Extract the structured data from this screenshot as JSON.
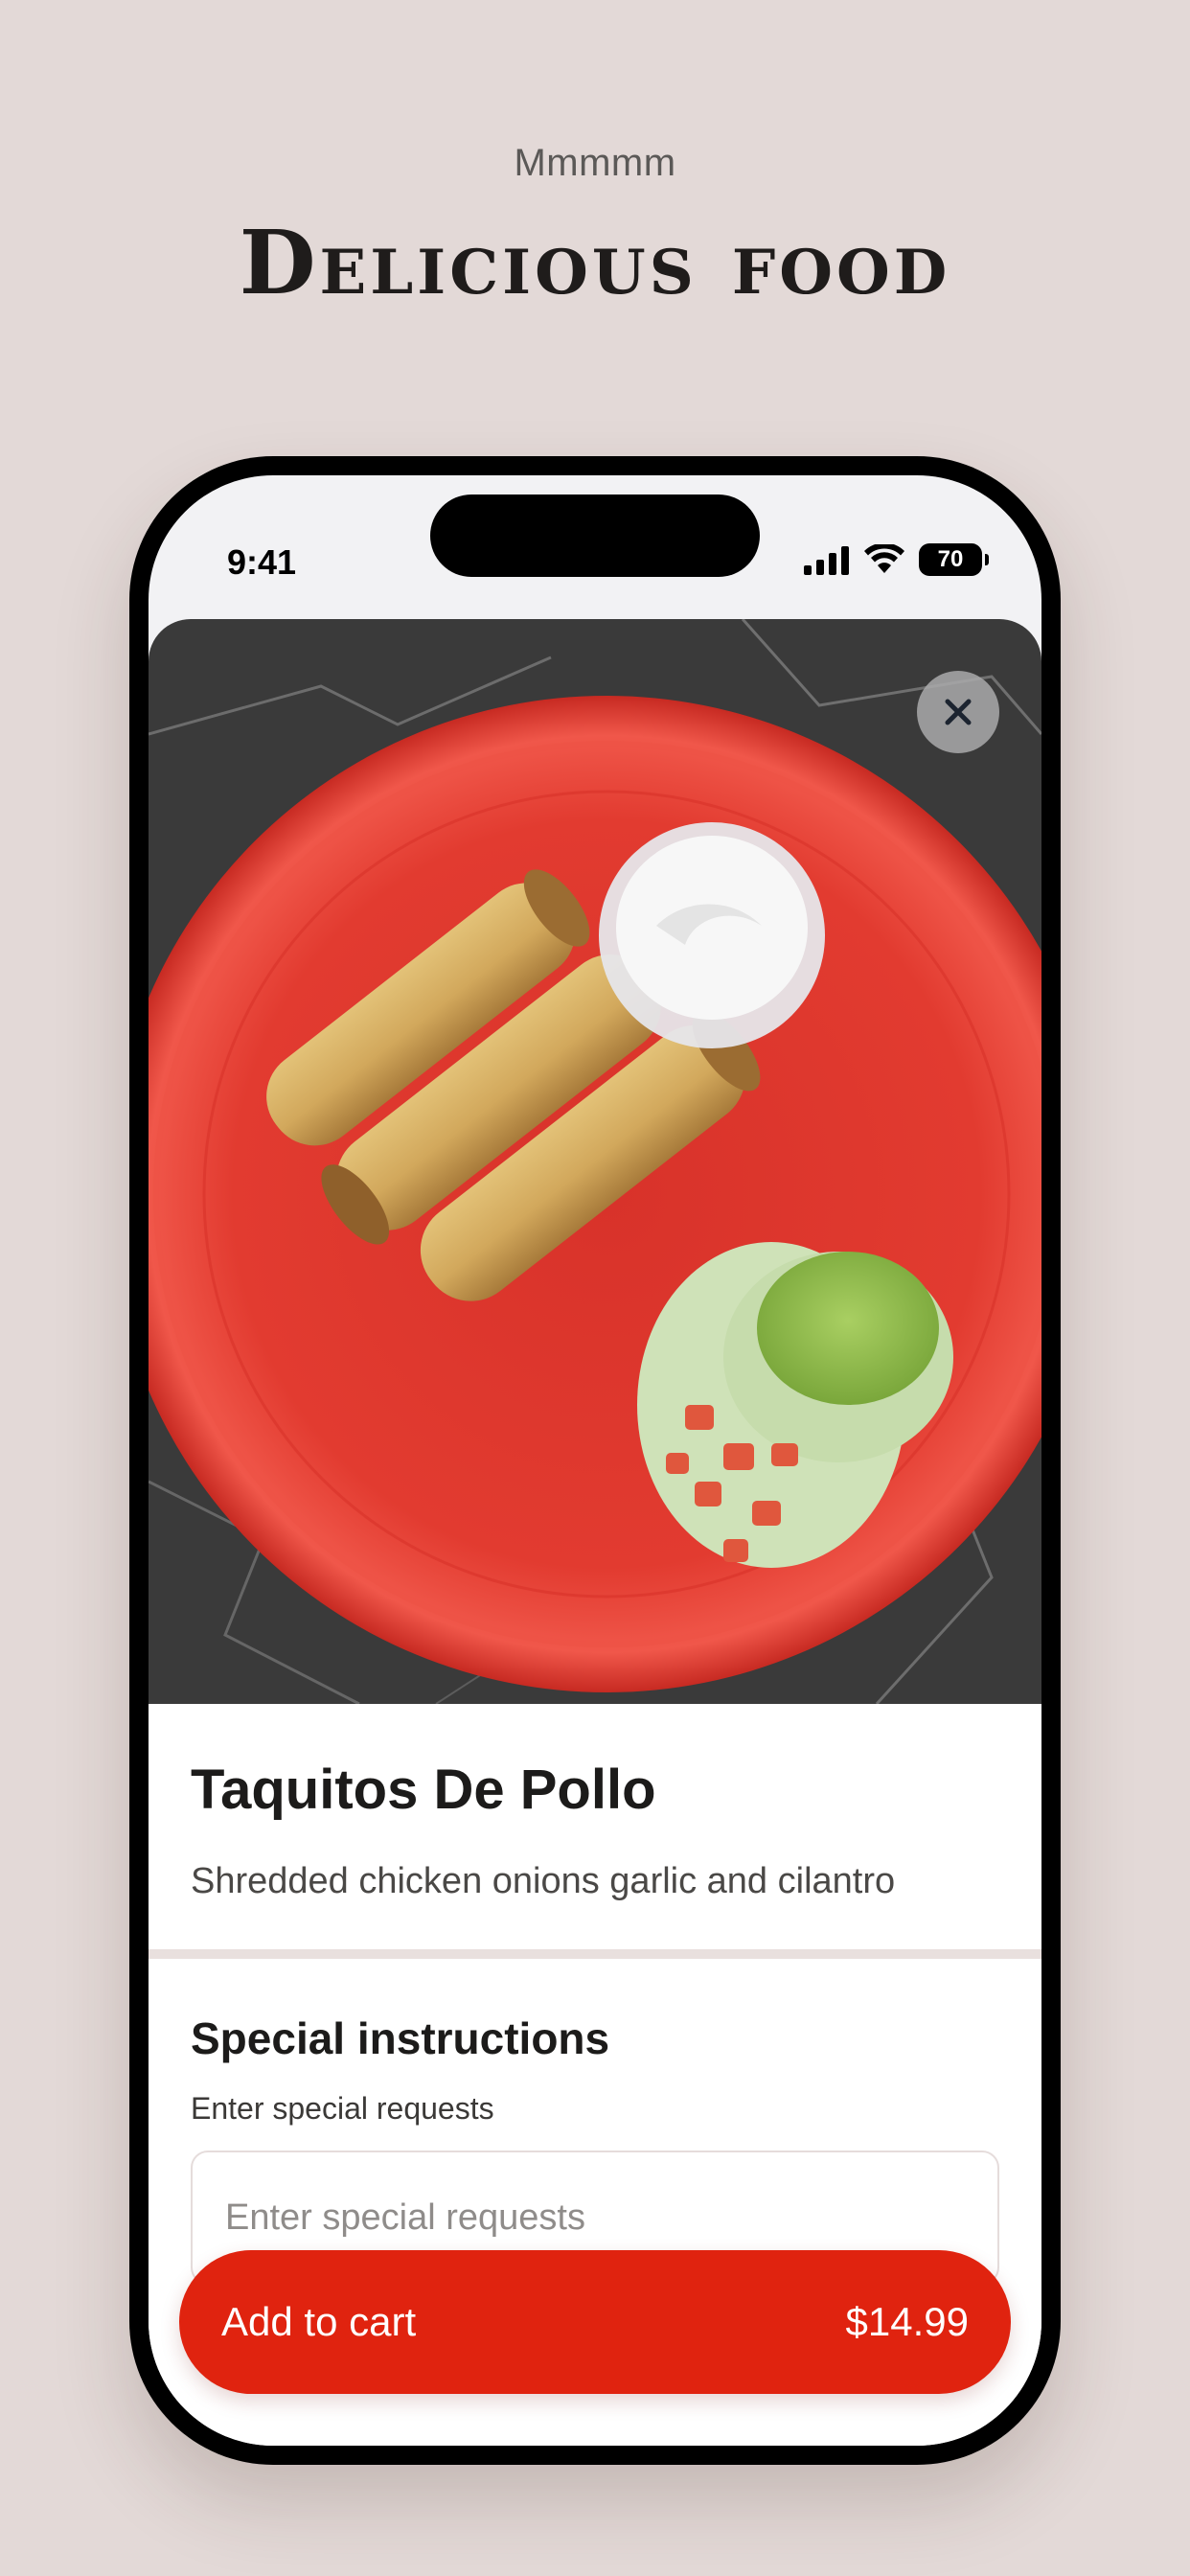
{
  "header": {
    "eyebrow": "Mmmmm",
    "headline": "Delicious food"
  },
  "status_bar": {
    "time": "9:41",
    "battery": "70",
    "icons": [
      "cellular-signal-icon",
      "wifi-icon",
      "battery-icon"
    ]
  },
  "product": {
    "image_icon": "taquitos-food-photo",
    "close_icon": "close-icon",
    "name": "Taquitos De Pollo",
    "description": "Shredded chicken onions garlic and cilantro"
  },
  "special_instructions": {
    "title": "Special instructions",
    "subtitle": "Enter special requests",
    "placeholder": "Enter special requests",
    "value": ""
  },
  "cart": {
    "label": "Add to cart",
    "price": "$14.99"
  },
  "colors": {
    "background": "#e3d9d7",
    "accent": "#e0230f",
    "plate": "#e33b2e"
  }
}
